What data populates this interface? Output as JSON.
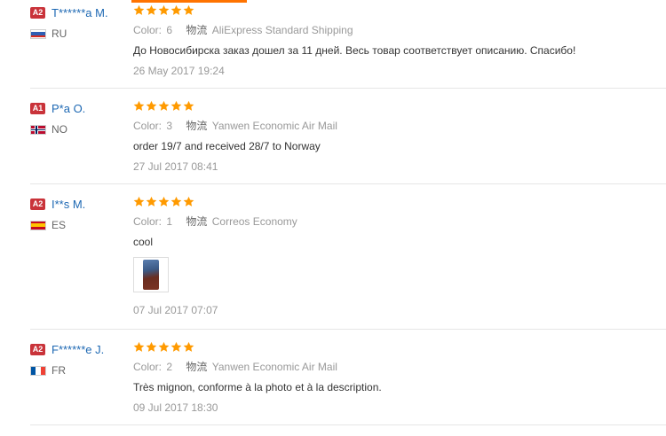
{
  "reviews": [
    {
      "badge": "A2",
      "user": "T******a M.",
      "country": "RU",
      "rating": 5,
      "color_label": "Color:",
      "color_value": "6",
      "shipping_label": "物流",
      "shipping_value": "AliExpress Standard Shipping",
      "text": "До Новосибирска заказ дошел за 11 дней. Весь товар соответствует описанию. Спасибо!",
      "date": "26 May 2017 19:24"
    },
    {
      "badge": "A1",
      "user": "P*a O.",
      "country": "NO",
      "rating": 5,
      "color_label": "Color:",
      "color_value": "3",
      "shipping_label": "物流",
      "shipping_value": "Yanwen Economic Air Mail",
      "text": "order 19/7 and received 28/7 to Norway",
      "date": "27 Jul 2017 08:41"
    },
    {
      "badge": "A2",
      "user": "I**s M.",
      "country": "ES",
      "rating": 5,
      "color_label": "Color:",
      "color_value": "1",
      "shipping_label": "物流",
      "shipping_value": "Correos Economy",
      "text": "cool",
      "date": "07 Jul 2017 07:07"
    },
    {
      "badge": "A2",
      "user": "F******e J.",
      "country": "FR",
      "rating": 5,
      "color_label": "Color:",
      "color_value": "2",
      "shipping_label": "物流",
      "shipping_value": "Yanwen Economic Air Mail",
      "text": "Très mignon, conforme à la photo et à la description.",
      "date": "09 Jul 2017 18:30"
    }
  ],
  "colors": {
    "accent": "#ff7300",
    "star": "#ff9a00",
    "badge": "#c9333a",
    "username": "#1d68b3"
  },
  "icons": {
    "star": "star-icon",
    "flag": "flag-icon"
  }
}
